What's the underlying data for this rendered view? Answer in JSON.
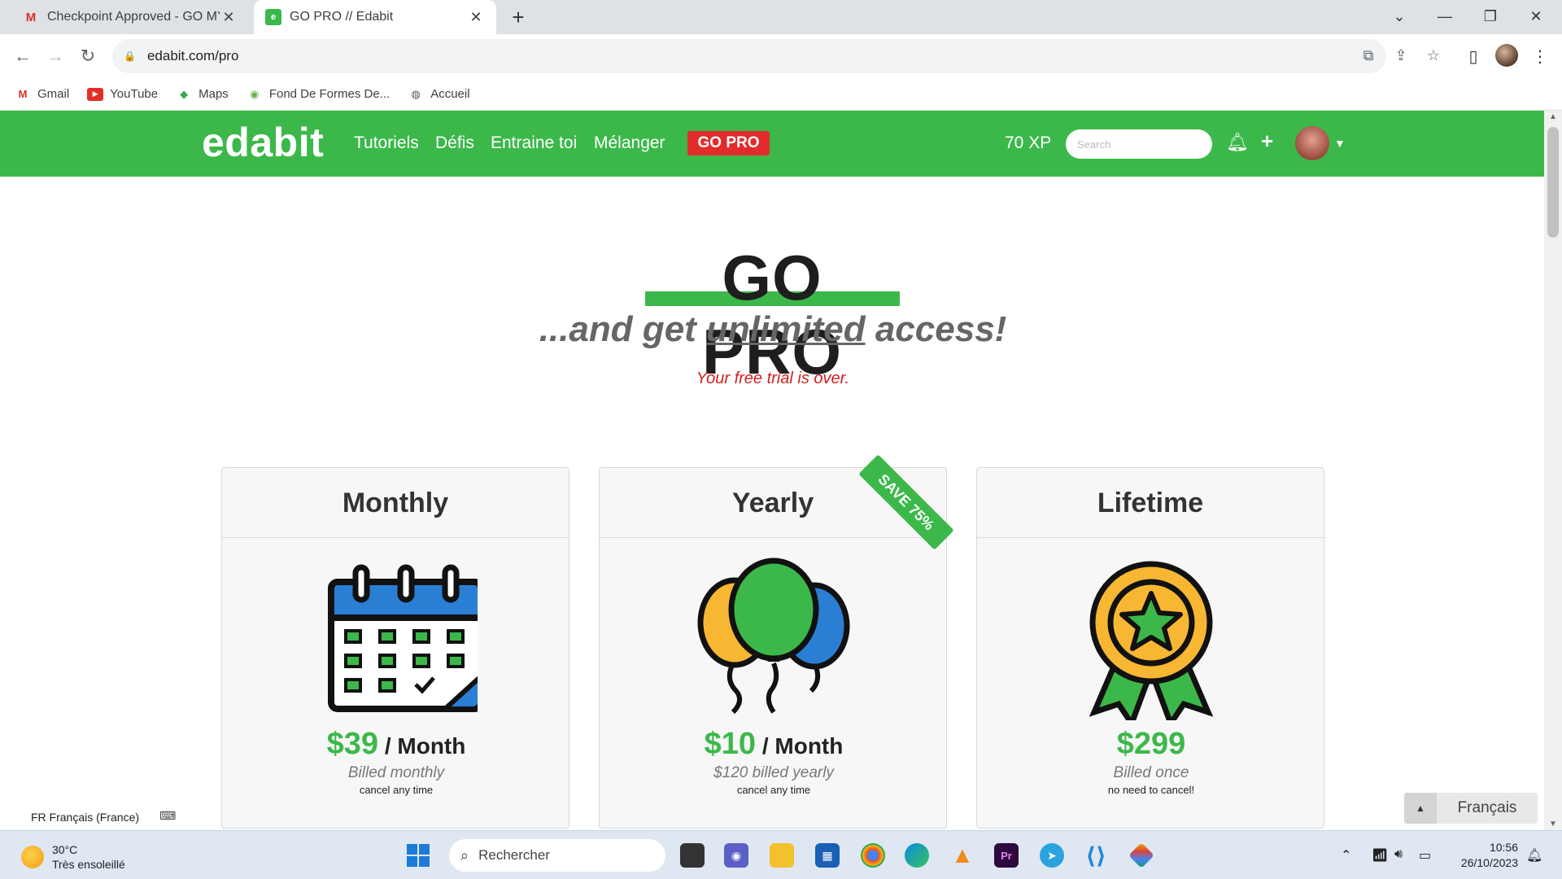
{
  "browser": {
    "tabs": [
      {
        "title": "Checkpoint Approved - GO MY C",
        "favicon": "gmail-icon",
        "active": false
      },
      {
        "title": "GO PRO // Edabit",
        "favicon": "edabit-icon",
        "active": true
      }
    ],
    "url": "edabit.com/pro",
    "bookmarks": [
      {
        "label": "Gmail",
        "icon": "gmail-icon"
      },
      {
        "label": "YouTube",
        "icon": "youtube-icon"
      },
      {
        "label": "Maps",
        "icon": "maps-icon"
      },
      {
        "label": "Fond De Formes De...",
        "icon": "shapes-icon"
      },
      {
        "label": "Accueil",
        "icon": "globe-icon"
      }
    ]
  },
  "header": {
    "logo": "edabit",
    "nav": [
      "Tutoriels",
      "Défis",
      "Entraine toi",
      "Mélanger"
    ],
    "go_pro": "GO PRO",
    "xp": "70 XP",
    "search_placeholder": "Search"
  },
  "hero": {
    "title": "GO PRO",
    "subtitle_pre": "...and get ",
    "subtitle_em": "unlimited",
    "subtitle_post": " access!",
    "trial_notice": "Your free trial is over."
  },
  "plans": [
    {
      "name": "Monthly",
      "amount": "$39",
      "period": " / Month",
      "billed": "Billed monthly",
      "note": "cancel any time",
      "icon": "calendar-icon"
    },
    {
      "name": "Yearly",
      "amount": "$10",
      "period": " / Month",
      "billed": "$120 billed yearly",
      "note": "cancel any time",
      "icon": "balloons-icon",
      "ribbon": "SAVE 75%"
    },
    {
      "name": "Lifetime",
      "amount": "$299",
      "period": "",
      "billed": "Billed once",
      "note": "no need to cancel!",
      "icon": "award-badge-icon"
    }
  ],
  "footer": {
    "lang_left": "FR Français (France)",
    "lang_switch": "Français"
  },
  "taskbar": {
    "temperature": "30°C",
    "weather": "Très ensoleillé",
    "search": "Rechercher",
    "time": "10:56",
    "date": "26/10/2023"
  },
  "colors": {
    "brand_green": "#3cb84a",
    "pro_red": "#e22b2b",
    "trial_red": "#d02020"
  }
}
